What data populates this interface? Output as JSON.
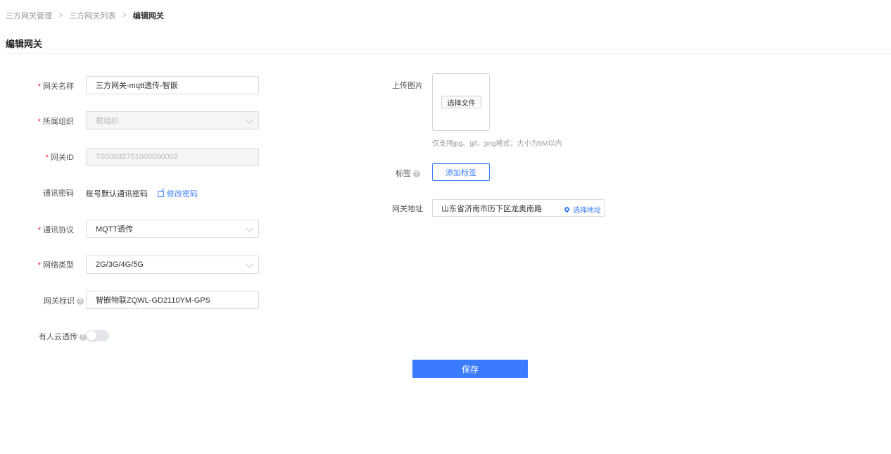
{
  "breadcrumb": {
    "items": [
      "三方网关管理",
      "三方网关列表"
    ],
    "current": "编辑网关",
    "separator": ">"
  },
  "page": {
    "title": "编辑网关"
  },
  "form": {
    "name": {
      "label": "网关名称",
      "value": "三方网关-mqtt透传-智嵌",
      "required": true
    },
    "org": {
      "label": "所属组织",
      "placeholder": "根组织",
      "required": true,
      "disabled": true
    },
    "gateway_id": {
      "label": "网关ID",
      "value": "T000032751000000002",
      "required": true,
      "disabled": true
    },
    "password": {
      "label": "通讯密码",
      "value": "账号默认通讯密码",
      "edit_label": "修改密码"
    },
    "protocol": {
      "label": "通讯协议",
      "value": "MQTT透传",
      "required": true
    },
    "network": {
      "label": "网络类型",
      "value": "2G/3G/4G/5G",
      "required": true
    },
    "identifier": {
      "label": "网关标识",
      "value": "智嵌物联ZQWL-GD2110YM-GPS",
      "help": "?"
    },
    "cloud": {
      "label": "有人云透传",
      "help": "?",
      "enabled": false
    },
    "upload": {
      "label": "上传图片",
      "button": "选择文件",
      "hint": "仅支持jpg、gif、png格式；大小为5M以内"
    },
    "tags": {
      "label": "标签",
      "help": "?",
      "button": "添加标签"
    },
    "address": {
      "label": "网关地址",
      "value": "山东省济南市历下区龙奥南路",
      "select_label": "选择地址"
    }
  },
  "actions": {
    "save": "保存"
  },
  "colors": {
    "primary": "#3b7cff",
    "required": "#f5222d"
  },
  "required_mark": "*"
}
